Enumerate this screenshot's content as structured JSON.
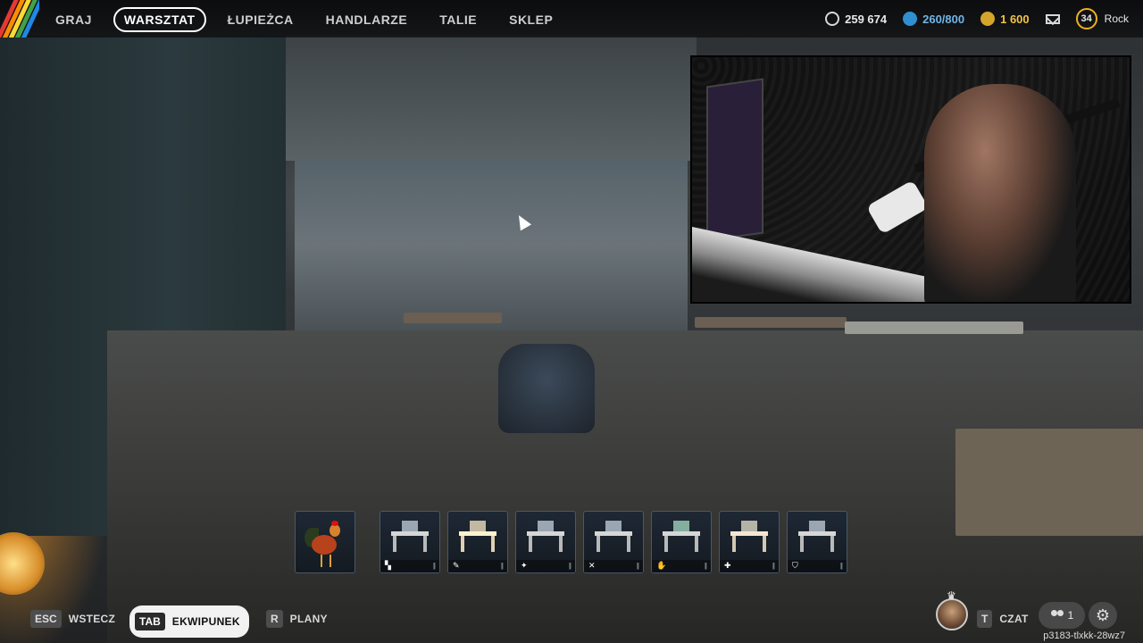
{
  "nav": {
    "items": [
      {
        "label": "GRAJ"
      },
      {
        "label": "WARSZTAT",
        "active": true
      },
      {
        "label": "ŁUPIEŻCA"
      },
      {
        "label": "HANDLARZE"
      },
      {
        "label": "TALIE"
      },
      {
        "label": "SKLEP"
      }
    ]
  },
  "currencies": {
    "renown": "259 674",
    "credits": "260/800",
    "gold": "1 600"
  },
  "profile": {
    "level": "34",
    "name": "Rock"
  },
  "hotbar": {
    "slots": [
      {
        "name": "rooster",
        "icon": "rooster-icon"
      },
      {
        "name": "workbench-1",
        "icon": "bench-icon"
      },
      {
        "name": "workbench-2",
        "icon": "wrench-icon"
      },
      {
        "name": "workbench-3",
        "icon": "bolt-icon"
      },
      {
        "name": "workbench-4",
        "icon": "crossed-tools-icon"
      },
      {
        "name": "workbench-5",
        "icon": "hand-icon"
      },
      {
        "name": "workbench-6",
        "icon": "medkit-icon"
      },
      {
        "name": "workbench-7",
        "icon": "shield-icon"
      }
    ]
  },
  "bottom": {
    "back_key": "ESC",
    "back_label": "WSTECZ",
    "tab_key": "TAB",
    "tab_label": "EKWIPUNEK",
    "plans_key": "R",
    "plans_label": "PLANY",
    "chat_key": "T",
    "chat_label": "CZAT",
    "friends_count": "1",
    "session_id": "p3183-tlxkk-28wz7"
  }
}
